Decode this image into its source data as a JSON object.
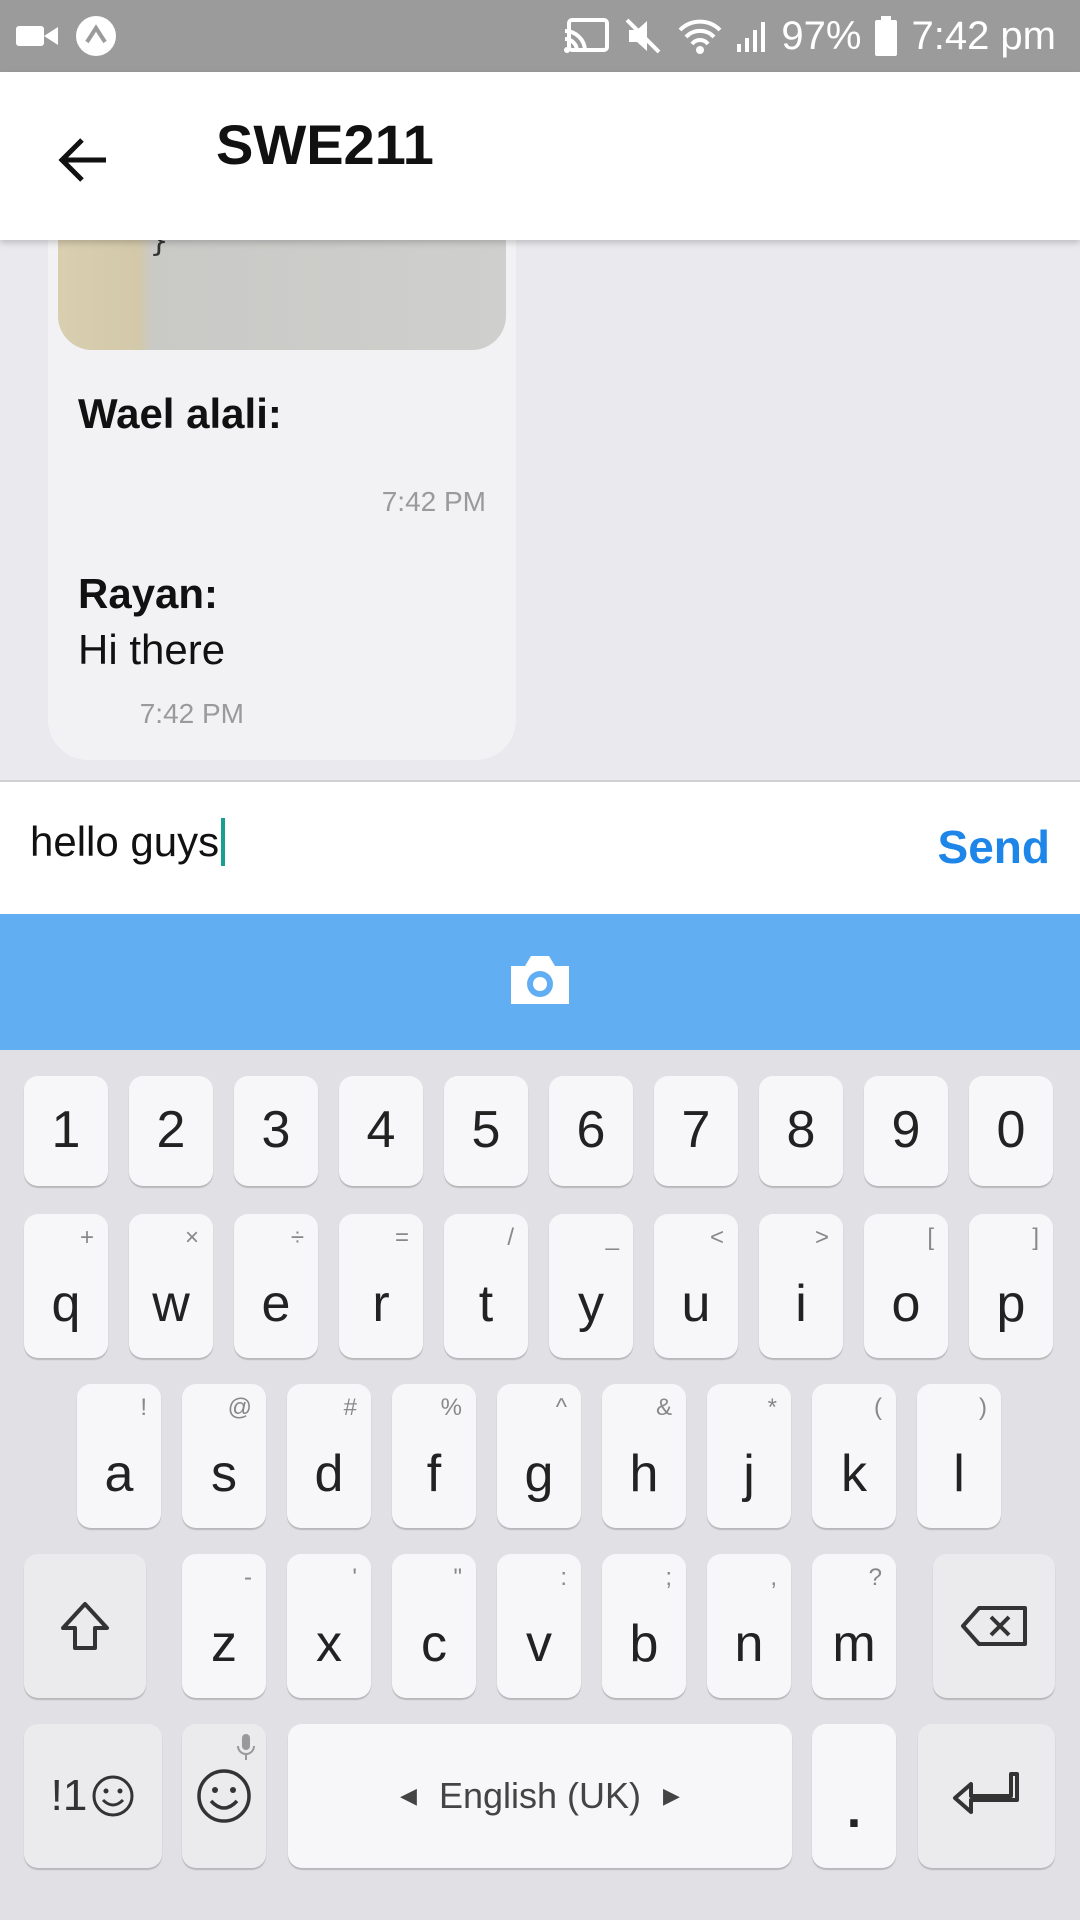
{
  "status_bar": {
    "battery": "97%",
    "time": "7:42 pm"
  },
  "header": {
    "title": "SWE211"
  },
  "messages": [
    {
      "code_lines": [
        "}",
        "}"
      ],
      "sender": "Wael alali:",
      "text": "",
      "time": "7:42 PM"
    },
    {
      "sender": "Rayan:",
      "text": "Hi there",
      "time": "7:42 PM"
    }
  ],
  "composer": {
    "value": "hello guys",
    "send_label": "Send"
  },
  "keyboard": {
    "number_row": [
      "1",
      "2",
      "3",
      "4",
      "5",
      "6",
      "7",
      "8",
      "9",
      "0"
    ],
    "row1": [
      {
        "key": "q",
        "hint": "+"
      },
      {
        "key": "w",
        "hint": "×"
      },
      {
        "key": "e",
        "hint": "÷"
      },
      {
        "key": "r",
        "hint": "="
      },
      {
        "key": "t",
        "hint": "/"
      },
      {
        "key": "y",
        "hint": "_"
      },
      {
        "key": "u",
        "hint": "<"
      },
      {
        "key": "i",
        "hint": ">"
      },
      {
        "key": "o",
        "hint": "["
      },
      {
        "key": "p",
        "hint": "]"
      }
    ],
    "row2": [
      {
        "key": "a",
        "hint": "!"
      },
      {
        "key": "s",
        "hint": "@"
      },
      {
        "key": "d",
        "hint": "#"
      },
      {
        "key": "f",
        "hint": "%"
      },
      {
        "key": "g",
        "hint": "^"
      },
      {
        "key": "h",
        "hint": "&"
      },
      {
        "key": "j",
        "hint": "*"
      },
      {
        "key": "k",
        "hint": "("
      },
      {
        "key": "l",
        "hint": ")"
      }
    ],
    "row3": [
      {
        "key": "z",
        "hint": "-"
      },
      {
        "key": "x",
        "hint": "'"
      },
      {
        "key": "c",
        "hint": "\""
      },
      {
        "key": "v",
        "hint": ":"
      },
      {
        "key": "b",
        "hint": ";"
      },
      {
        "key": "n",
        "hint": ","
      },
      {
        "key": "m",
        "hint": "?"
      }
    ],
    "symbols_label": "!1",
    "space_label": "English (UK)",
    "period_label": "."
  }
}
